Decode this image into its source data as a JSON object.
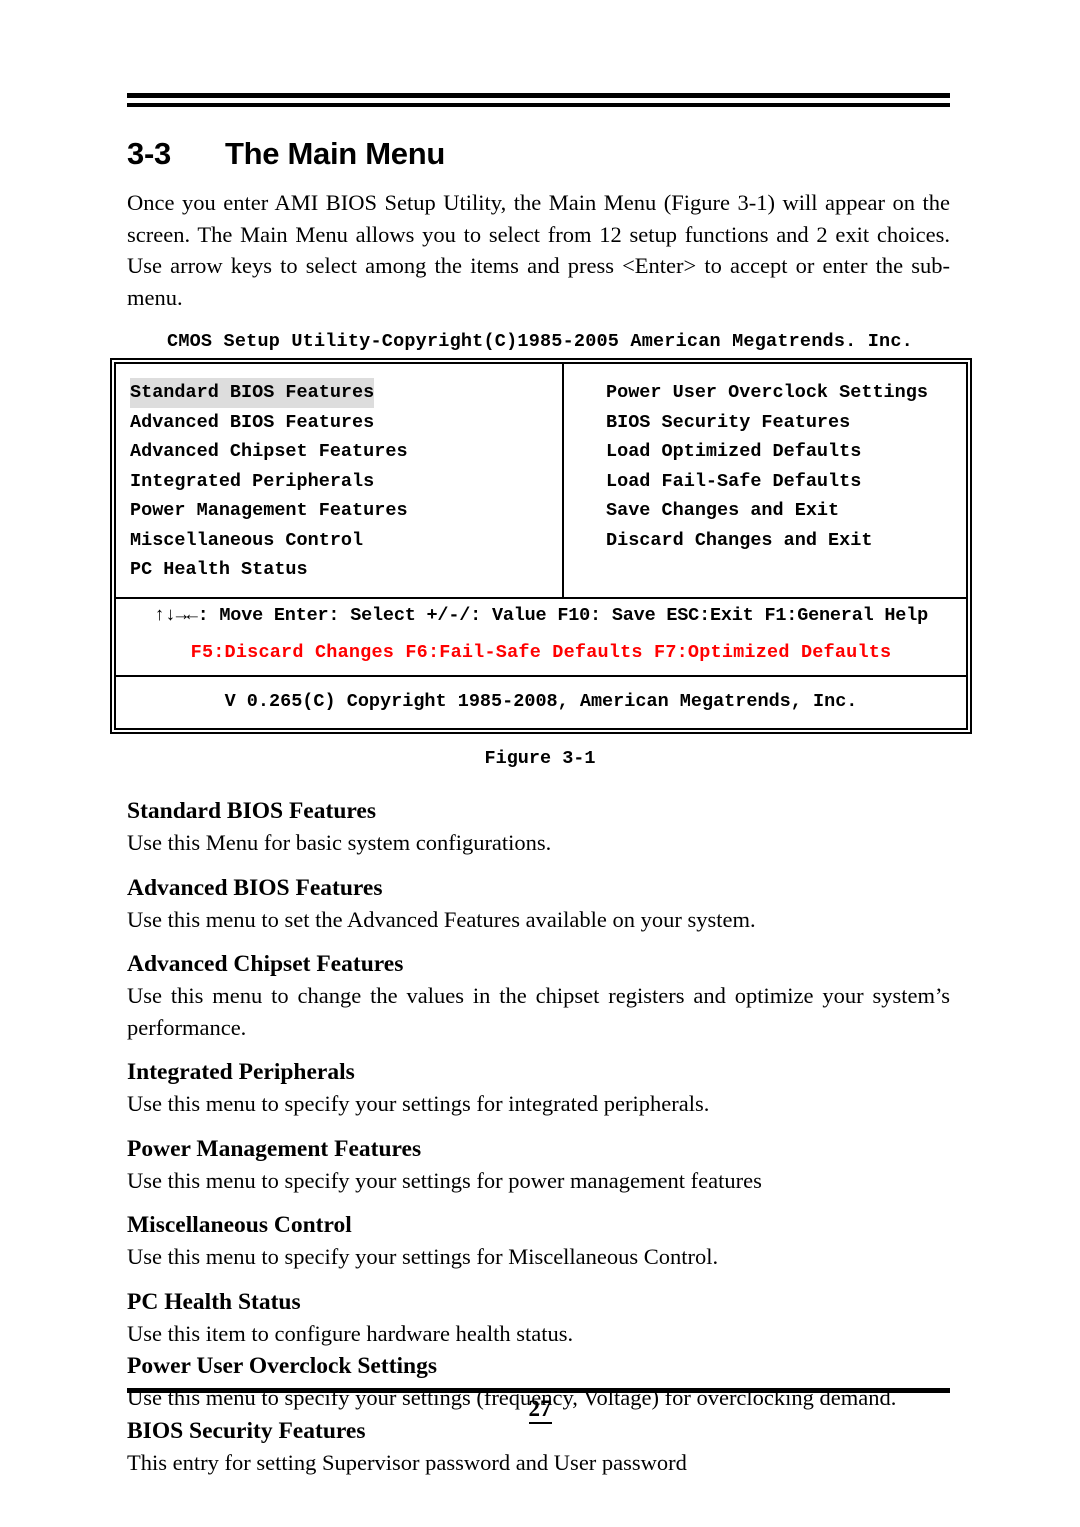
{
  "section": {
    "number": "3-3",
    "title": "The Main Menu",
    "intro": "Once you enter AMI BIOS Setup Utility, the Main Menu (Figure 3-1) will appear on the screen.   The Main Menu allows you to select from 12 setup functions and 2 exit choices. Use arrow keys to select among the items and press <Enter> to accept or enter the sub-menu."
  },
  "bios": {
    "title": "CMOS Setup Utility-Copyright(C)1985-2005 American Megatrends. Inc.",
    "left_column": [
      "Standard BIOS Features",
      "Advanced BIOS Features",
      "Advanced Chipset Features",
      "Integrated Peripherals",
      "Power Management Features",
      "Miscellaneous Control",
      "PC Health Status"
    ],
    "right_column": [
      "Power User Overclock Settings",
      "BIOS Security Features",
      "Load Optimized Defaults",
      "Load Fail-Safe Defaults",
      "Save Changes and Exit",
      "Discard Changes and Exit"
    ],
    "selected_item": "Standard BIOS Features",
    "help_line": "↑↓→←: Move  Enter: Select +/-/: Value F10: Save ESC:Exit F1:General Help",
    "function_keys": "F5:Discard Changes  F6:Fail-Safe Defaults   F7:Optimized Defaults",
    "function_keys_color": "#ff0000",
    "highlight_color": "#dddddd",
    "version_line": "V 0.265(C) Copyright 1985-2008, American Megatrends, Inc."
  },
  "figure_caption": "Figure 3-1",
  "descriptions": [
    {
      "heading": "Standard BIOS Features",
      "body": "Use this Menu for basic system configurations."
    },
    {
      "heading": "Advanced BIOS Features",
      "body": "Use this menu to set the Advanced Features available on your system."
    },
    {
      "heading": "Advanced Chipset Features",
      "body": "Use this menu to change the values in the chipset registers and optimize your system’s performance."
    },
    {
      "heading": "Integrated Peripherals",
      "body": "Use this menu to specify your settings for integrated peripherals."
    },
    {
      "heading": "Power Management Features",
      "body": "Use this menu to specify your settings for power management features"
    },
    {
      "heading": "Miscellaneous Control",
      "body": "Use this menu to specify your settings for Miscellaneous Control."
    },
    {
      "heading": "PC Health Status",
      "body": "Use this item to configure hardware health status."
    },
    {
      "heading": "Power User Overclock Settings",
      "body": "Use this menu to specify your settings (frequency, Voltage) for overclocking demand."
    },
    {
      "heading": "BIOS Security Features",
      "body": "This entry for setting Supervisor password and User password"
    }
  ],
  "footer": {
    "page_number": "27"
  }
}
